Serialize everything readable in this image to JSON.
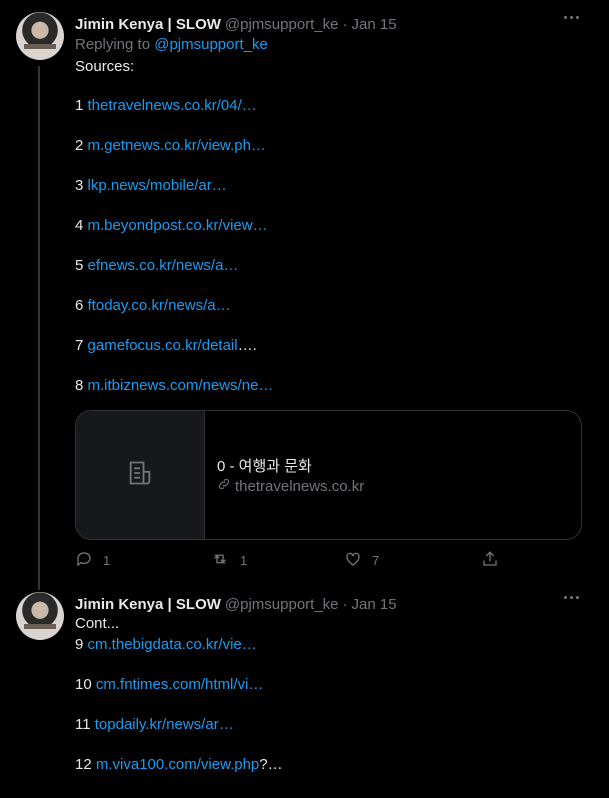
{
  "tweets": [
    {
      "author": {
        "name": "Jimin Kenya | SLOW",
        "handle": "@pjmsupport_ke"
      },
      "separator": "·",
      "date": "Jan 15",
      "reply": {
        "prefix": "Replying to",
        "mention": "@pjmsupport_ke"
      },
      "lines": [
        {
          "text": "Sources:"
        },
        {
          "num": "1",
          "link": "thetravelnews.co.kr/04/…"
        },
        {
          "num": "2",
          "link": "m.getnews.co.kr/view.ph…"
        },
        {
          "num": "3",
          "link": "lkp.news/mobile/ar…"
        },
        {
          "num": "4",
          "link": "m.beyondpost.co.kr/view…"
        },
        {
          "num": "5",
          "link": "efnews.co.kr/news/a…"
        },
        {
          "num": "6",
          "link": "ftoday.co.kr/news/a…"
        },
        {
          "num": "7",
          "link": "gamefocus.co.kr/detail",
          "suffix": "…."
        },
        {
          "num": "8",
          "link": "m.itbiznews.com/news/ne…"
        }
      ],
      "card": {
        "title": "0 - 여행과 문화",
        "domain": "thetravelnews.co.kr",
        "thumb_icon": "document-icon",
        "domain_icon": "link-icon"
      },
      "actions": {
        "reply_count": "1",
        "retweet_count": "1",
        "like_count": "7"
      }
    },
    {
      "author": {
        "name": "Jimin Kenya | SLOW",
        "handle": "@pjmsupport_ke"
      },
      "separator": "·",
      "date": "Jan 15",
      "lines": [
        {
          "text": "Cont..."
        },
        {
          "num": "9",
          "link": "cm.thebigdata.co.kr/vie…"
        },
        {
          "num": "10",
          "link": "cm.fntimes.com/html/vi…"
        },
        {
          "num": "11",
          "link": "topdaily.kr/news/ar…"
        },
        {
          "num": "12",
          "link": "m.viva100.com/view.php",
          "suffix": "?…"
        }
      ]
    }
  ],
  "colors": {
    "background": "#000000",
    "text": "#e7e9ea",
    "muted": "#71767b",
    "link": "#1d9bf0",
    "border": "#2f3336"
  }
}
